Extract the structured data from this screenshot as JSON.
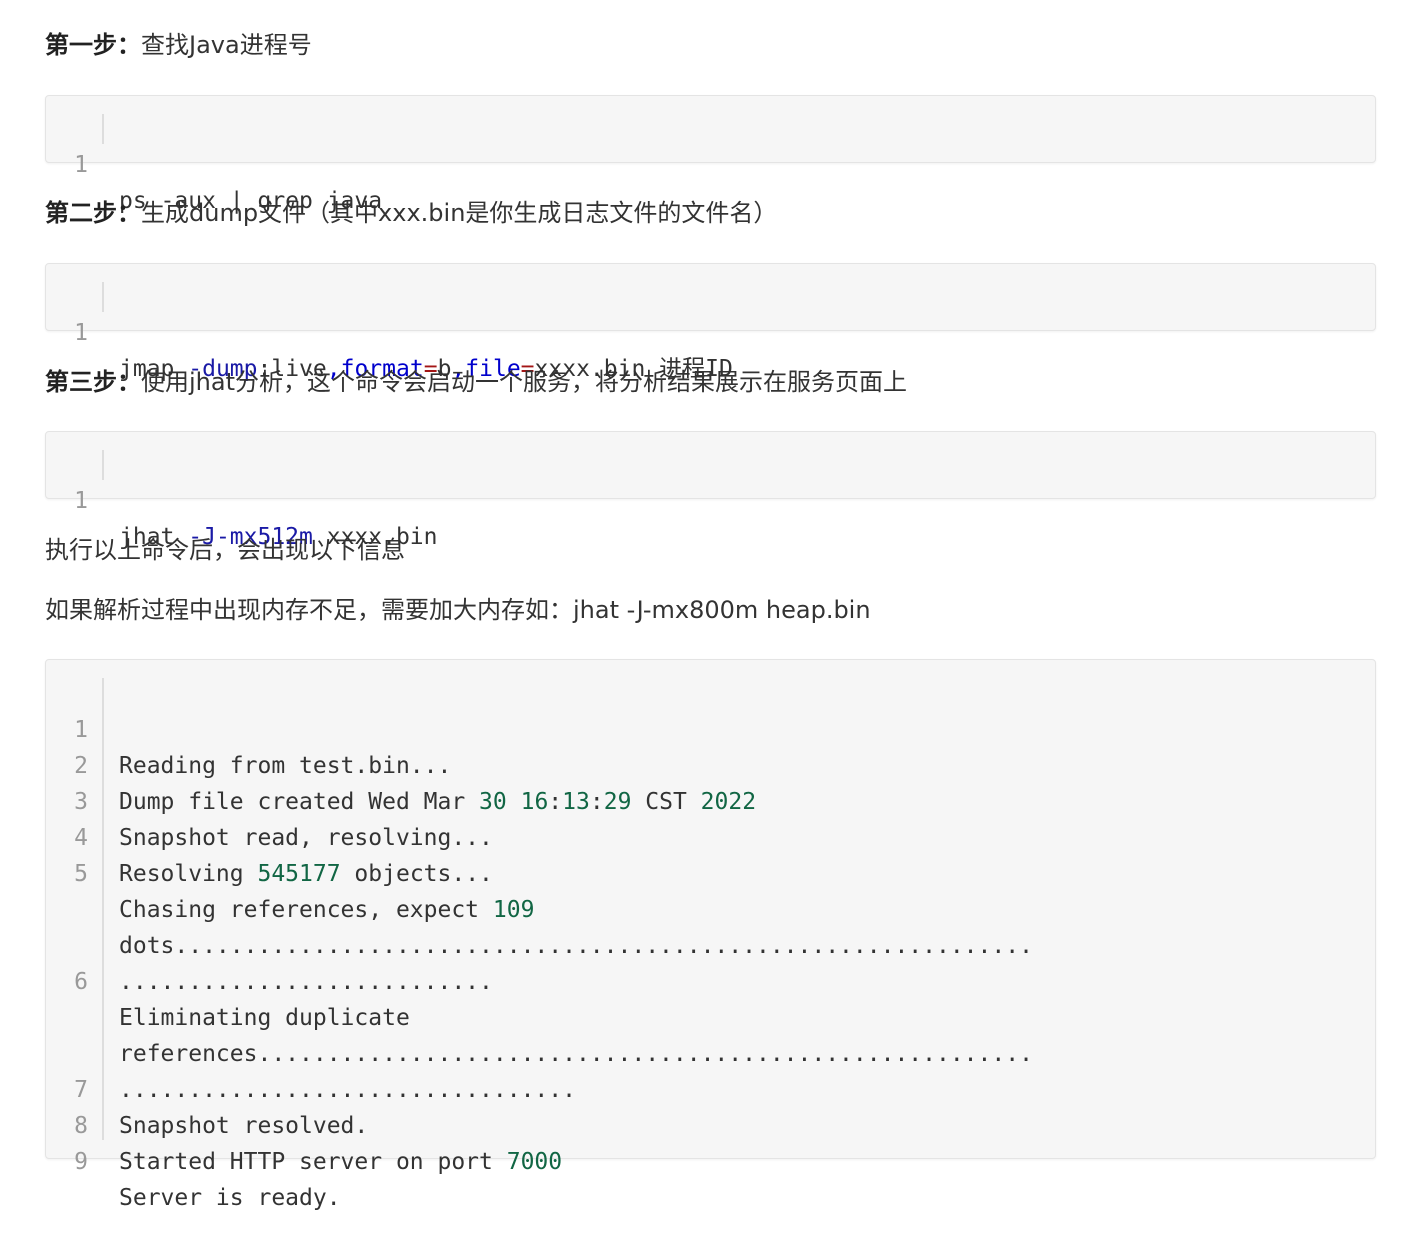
{
  "steps": [
    {
      "label": "第一步：",
      "text": "查找Java进程号"
    },
    {
      "label": "第二步：",
      "text": "生成dump文件（其中xxx.bin是你生成日志文件的文件名）"
    },
    {
      "label": "第三步：",
      "text": "使用jhat分析，这个命令会启动一个服务，将分析结果展示在服务页面上"
    }
  ],
  "code1": {
    "lines": [
      {
        "num": "1",
        "text": "ps -aux | grep java"
      }
    ]
  },
  "code2": {
    "lines": [
      {
        "num": "1",
        "parts": [
          "jmap ",
          "-dump",
          ":live",
          ",",
          "format",
          "=",
          "b",
          ",",
          "file",
          "=",
          "xxxx.bin 进程ID"
        ]
      }
    ]
  },
  "code3": {
    "lines": [
      {
        "num": "1",
        "parts": [
          "jhat ",
          "-J-mx512m",
          " xxxx.bin"
        ]
      }
    ]
  },
  "text_after": "执行以上命令后，会出现以下信息",
  "text_memory": "如果解析过程中出现内存不足，需要加大内存如：jhat -J-mx800m heap.bin",
  "output": {
    "lines": [
      {
        "num": "1",
        "parts": [
          "Reading from test.bin..."
        ]
      },
      {
        "num": "2",
        "parts": [
          "Dump file created Wed Mar ",
          "30",
          " ",
          "16",
          ":",
          "13",
          ":",
          "29",
          " CST ",
          "2022"
        ]
      },
      {
        "num": "3",
        "parts": [
          "Snapshot read, resolving..."
        ]
      },
      {
        "num": "4",
        "parts": [
          "Resolving ",
          "545177",
          " objects..."
        ]
      },
      {
        "num": "5",
        "parts": [
          "Chasing references, expect ",
          "109"
        ]
      },
      {
        "num": "",
        "parts": [
          "dots.............................................................."
        ]
      },
      {
        "num": "",
        "parts": [
          "..........................."
        ]
      },
      {
        "num": "6",
        "parts": [
          "Eliminating duplicate"
        ]
      },
      {
        "num": "",
        "parts": [
          "references........................................................"
        ]
      },
      {
        "num": "",
        "parts": [
          "................................."
        ]
      },
      {
        "num": "7",
        "parts": [
          "Snapshot resolved."
        ]
      },
      {
        "num": "8",
        "parts": [
          "Started HTTP server on port ",
          "7000"
        ]
      },
      {
        "num": "9",
        "parts": [
          "Server is ready."
        ]
      }
    ]
  }
}
